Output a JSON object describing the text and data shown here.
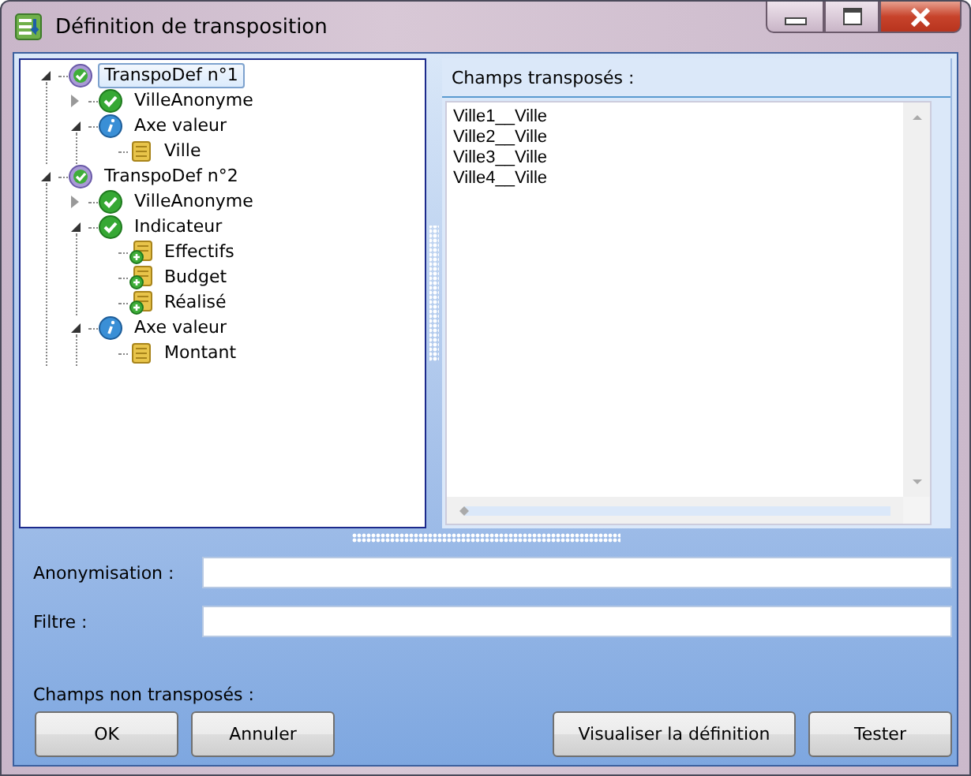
{
  "window": {
    "title": "Définition de transposition"
  },
  "tree": [
    {
      "label": "TranspoDef n°1",
      "kind": "definition",
      "selected": true,
      "expanded": true,
      "children": [
        {
          "label": "VilleAnonyme",
          "kind": "valid",
          "selected": false,
          "expanded": false
        },
        {
          "label": "Axe valeur",
          "kind": "info",
          "selected": false,
          "expanded": true,
          "children": [
            {
              "label": "Ville",
              "kind": "field",
              "selected": false
            }
          ]
        }
      ]
    },
    {
      "label": "TranspoDef n°2",
      "kind": "definition",
      "selected": false,
      "expanded": true,
      "children": [
        {
          "label": "VilleAnonyme",
          "kind": "valid",
          "selected": false,
          "expanded": false
        },
        {
          "label": "Indicateur",
          "kind": "valid",
          "selected": false,
          "expanded": true,
          "children": [
            {
              "label": "Effectifs",
              "kind": "measure",
              "selected": false
            },
            {
              "label": "Budget",
              "kind": "measure",
              "selected": false
            },
            {
              "label": "Réalisé",
              "kind": "measure",
              "selected": false
            }
          ]
        },
        {
          "label": "Axe valeur",
          "kind": "info",
          "selected": false,
          "expanded": true,
          "children": [
            {
              "label": "Montant",
              "kind": "field",
              "selected": false
            }
          ]
        }
      ]
    }
  ],
  "transposed_fields": {
    "label": "Champs transposés :",
    "items": [
      "Ville1__Ville",
      "Ville2__Ville",
      "Ville3__Ville",
      "Ville4__Ville"
    ]
  },
  "fields": [
    {
      "label": "Anonymisation :"
    },
    {
      "label": "Filtre :"
    }
  ],
  "untransposed_label": "Champs non transposés :",
  "buttons": [
    {
      "label": "OK",
      "kind": "left"
    },
    {
      "label": "Annuler",
      "kind": "left"
    },
    {
      "label": "Visualiser la définition",
      "kind": "right"
    },
    {
      "label": "Tester",
      "kind": "right"
    }
  ]
}
